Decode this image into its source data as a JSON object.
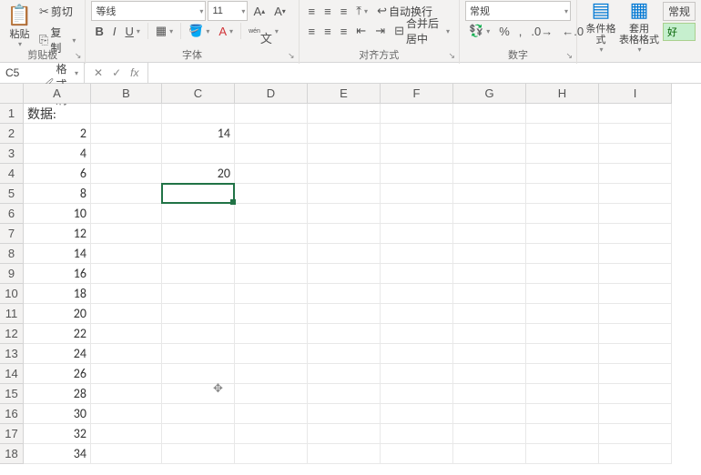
{
  "ribbon": {
    "clipboard": {
      "cut": "剪切",
      "copy": "复制",
      "paste": "粘贴",
      "formatPainter": "格式刷",
      "label": "剪贴板"
    },
    "font": {
      "name": "等线",
      "size": "11",
      "label": "字体"
    },
    "alignment": {
      "wrap": "自动换行",
      "merge": "合并后居中",
      "label": "对齐方式"
    },
    "number": {
      "format": "常规",
      "label": "数字"
    },
    "styles": {
      "cond": "条件格式",
      "table": "套用\n表格格式",
      "good": "好",
      "normal": "常规"
    }
  },
  "formulaBar": {
    "nameBox": "C5",
    "fx": "fx",
    "value": ""
  },
  "sheet": {
    "cols": [
      "A",
      "B",
      "C",
      "D",
      "E",
      "F",
      "G",
      "H",
      "I"
    ],
    "rows": [
      "1",
      "2",
      "3",
      "4",
      "5",
      "6",
      "7",
      "8",
      "9",
      "10",
      "11",
      "12",
      "13",
      "14",
      "15",
      "16",
      "17",
      "18"
    ],
    "data": {
      "A1": "数据:",
      "A2": "2",
      "A3": "4",
      "A4": "6",
      "A5": "8",
      "A6": "10",
      "A7": "12",
      "A8": "14",
      "A9": "16",
      "A10": "18",
      "A11": "20",
      "A12": "22",
      "A13": "24",
      "A14": "26",
      "A15": "28",
      "A16": "30",
      "A17": "32",
      "A18": "34",
      "C2": "14",
      "C4": "20"
    },
    "activeCell": "C5"
  }
}
